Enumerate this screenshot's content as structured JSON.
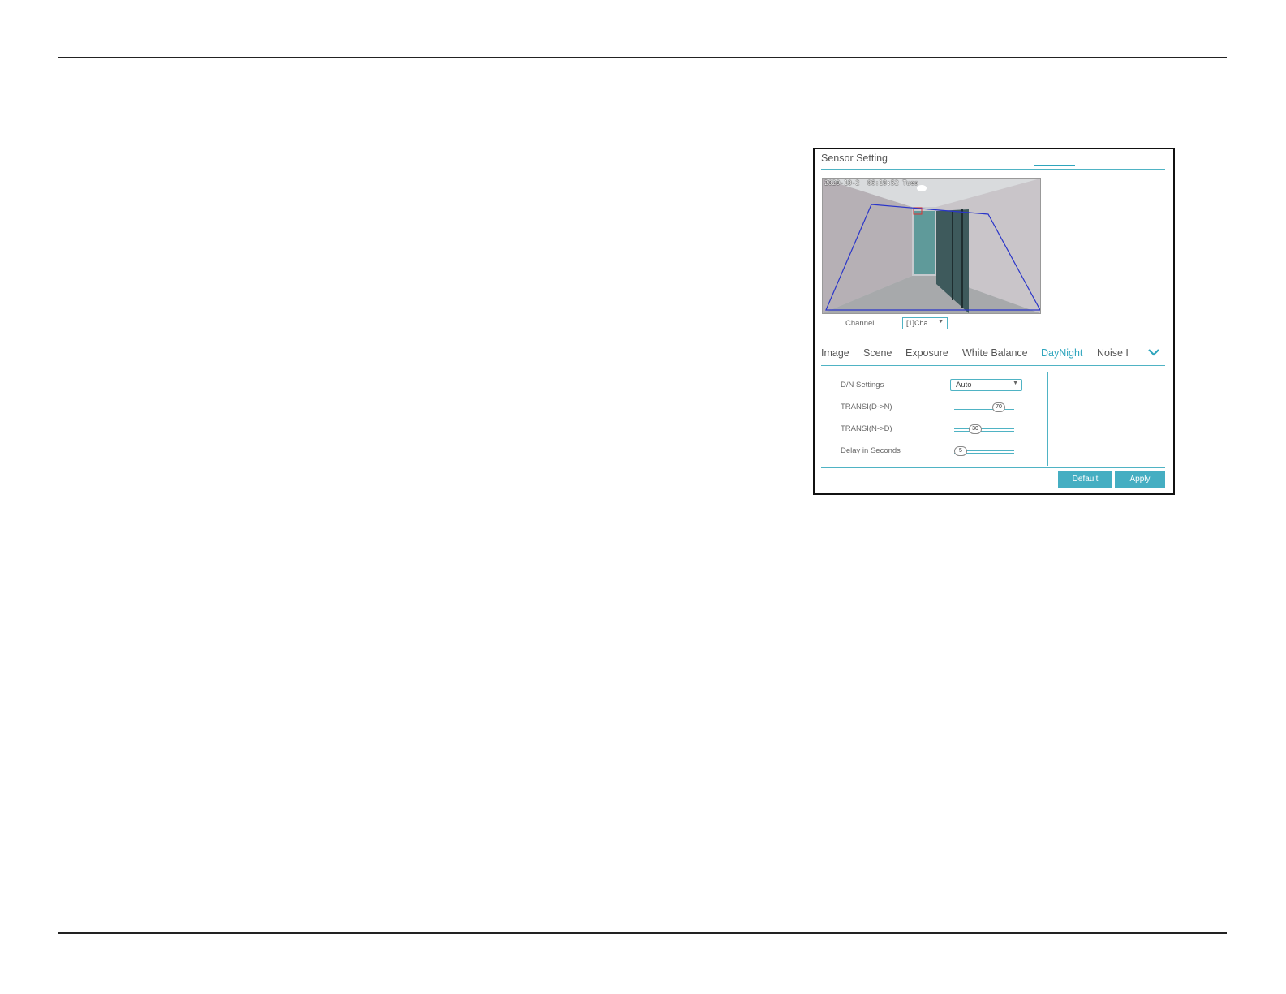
{
  "panel": {
    "title": "Sensor Setting",
    "preview": {
      "osd": "2020-10-2  06:19:52 Tues"
    },
    "channel": {
      "label": "Channel",
      "value": "[1]Cha..."
    },
    "tabs": [
      {
        "label": "Image",
        "active": false
      },
      {
        "label": "Scene",
        "active": false
      },
      {
        "label": "Exposure",
        "active": false
      },
      {
        "label": "White Balance",
        "active": false
      },
      {
        "label": "DayNight",
        "active": true
      },
      {
        "label": "Noise I",
        "active": false
      }
    ],
    "more_icon": "chevron-down-icon",
    "daynight": {
      "dn_settings_label": "D/N Settings",
      "dn_settings_value": "Auto",
      "transi_dn_label": "TRANSI(D->N)",
      "transi_dn_value": "70",
      "transi_nd_label": "TRANSI(N->D)",
      "transi_nd_value": "30",
      "delay_label": "Delay in Seconds",
      "delay_value": "5"
    },
    "buttons": {
      "default_label": "Default",
      "apply_label": "Apply"
    },
    "accent_color": "#2ea5bd",
    "button_color": "#45aec2"
  }
}
